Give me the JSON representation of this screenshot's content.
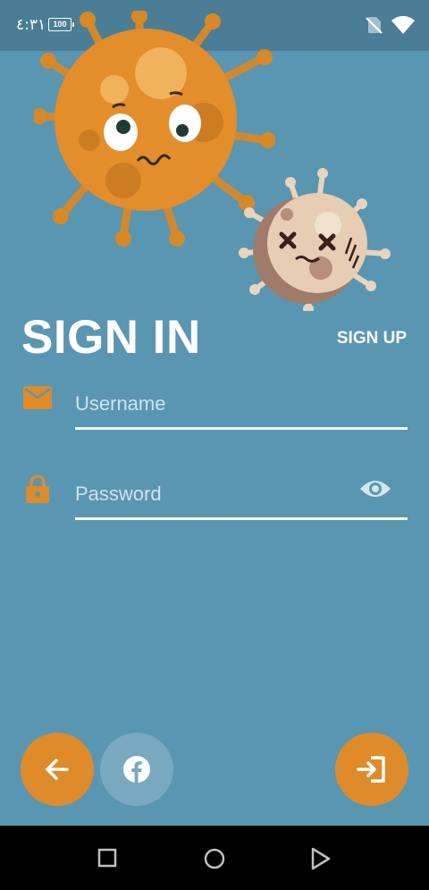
{
  "status_bar": {
    "time": "٤:٣١",
    "battery_label": "100"
  },
  "auth": {
    "title": "SIGN IN",
    "signup_label": "SIGN UP",
    "username_placeholder": "Username",
    "password_placeholder": "Password"
  },
  "colors": {
    "background": "#5896b2",
    "status_bar": "#497e96",
    "accent": "#e08b2a",
    "facebook_button": "#79a9c1",
    "nav_bar": "#000000"
  },
  "icons": {
    "username": "mail-icon",
    "password": "lock-icon",
    "visibility": "eye-icon",
    "back": "arrow-left-icon",
    "facebook": "facebook-icon",
    "login": "login-icon"
  }
}
